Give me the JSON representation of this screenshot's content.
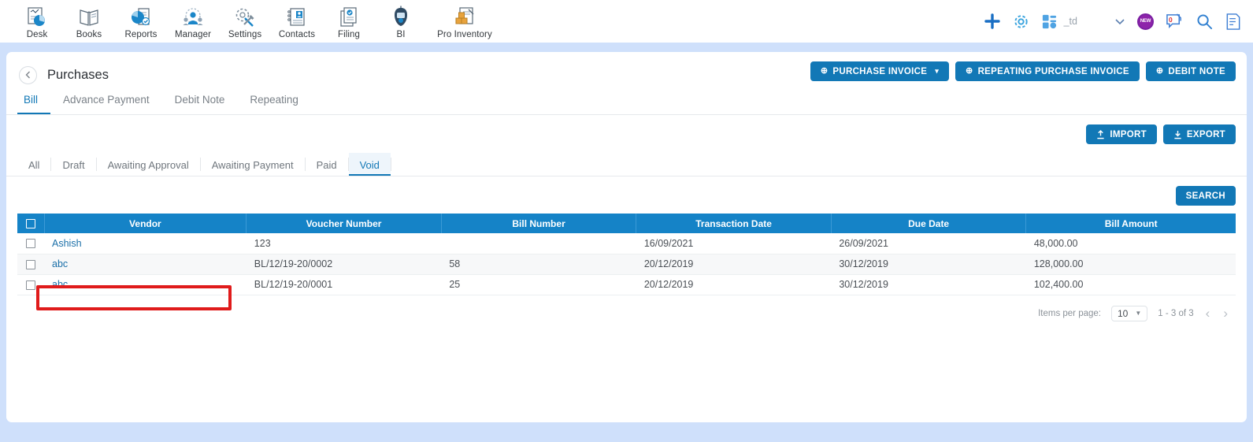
{
  "appbar": {
    "items": [
      {
        "label": "Desk",
        "icon": "desk-icon"
      },
      {
        "label": "Books",
        "icon": "books-icon"
      },
      {
        "label": "Reports",
        "icon": "reports-icon"
      },
      {
        "label": "Manager",
        "icon": "manager-icon"
      },
      {
        "label": "Settings",
        "icon": "settings-icon"
      },
      {
        "label": "Contacts",
        "icon": "contacts-icon"
      },
      {
        "label": "Filing",
        "icon": "filing-icon"
      },
      {
        "label": "BI",
        "icon": "bi-icon"
      },
      {
        "label": "Pro Inventory",
        "icon": "pro-inventory-icon"
      }
    ],
    "right": {
      "add_icon": "plus-icon",
      "settings_icon": "gear-icon",
      "apps_icon": "apps-grid-icon",
      "org_name": "_td",
      "chevron_icon": "chevron-down-icon",
      "new_badge": "NEW",
      "chat_icon": "chat-bubble-icon",
      "chat_count": "0",
      "search_icon": "search-icon",
      "notes_icon": "notes-icon"
    }
  },
  "page": {
    "title": "Purchases",
    "back_icon": "chevron-left-icon"
  },
  "head_actions": {
    "purchase_invoice": "PURCHASE INVOICE",
    "purchase_invoice_caret": "▾",
    "repeating_purchase_invoice": "REPEATING PURCHASE INVOICE",
    "debit_note": "DEBIT NOTE",
    "plus_icon": "⊕"
  },
  "tabs": [
    {
      "label": "Bill",
      "active": true
    },
    {
      "label": "Advance Payment",
      "active": false
    },
    {
      "label": "Debit Note",
      "active": false
    },
    {
      "label": "Repeating",
      "active": false
    }
  ],
  "io_buttons": {
    "import": "IMPORT",
    "export": "EXPORT"
  },
  "status_filters": [
    {
      "label": "All",
      "active": false
    },
    {
      "label": "Draft",
      "active": false
    },
    {
      "label": "Awaiting Approval",
      "active": false
    },
    {
      "label": "Awaiting Payment",
      "active": false
    },
    {
      "label": "Paid",
      "active": false
    },
    {
      "label": "Void",
      "active": true
    }
  ],
  "search": {
    "label": "SEARCH"
  },
  "table": {
    "columns": [
      "Vendor",
      "Voucher Number",
      "Bill Number",
      "Transaction Date",
      "Due Date",
      "Bill Amount"
    ],
    "rows": [
      {
        "vendor": "Ashish",
        "voucher_number": "123",
        "bill_number": "",
        "transaction_date": "16/09/2021",
        "due_date": "26/09/2021",
        "bill_amount": "48,000.00"
      },
      {
        "vendor": "abc",
        "voucher_number": "BL/12/19-20/0002",
        "bill_number": "58",
        "transaction_date": "20/12/2019",
        "due_date": "30/12/2019",
        "bill_amount": "128,000.00"
      },
      {
        "vendor": "abc",
        "voucher_number": "BL/12/19-20/0001",
        "bill_number": "25",
        "transaction_date": "20/12/2019",
        "due_date": "30/12/2019",
        "bill_amount": "102,400.00"
      }
    ]
  },
  "pagination": {
    "items_per_page_label": "Items per page:",
    "items_per_page_value": "10",
    "range": "1 - 3 of 3",
    "prev_icon": "chevron-left-icon",
    "next_icon": "chevron-right-icon"
  },
  "colors": {
    "accent": "#1278b6",
    "table_header": "#1583c7",
    "highlight": "#e01b1b",
    "page_bg": "#cfe0fb"
  }
}
